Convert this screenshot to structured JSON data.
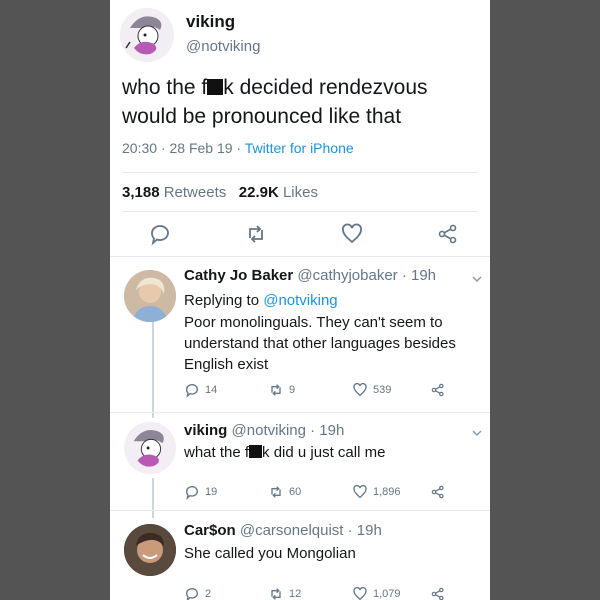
{
  "main_tweet": {
    "display_name": "viking",
    "handle": "@notviking",
    "text_before": "who the f",
    "text_after": "k decided rendezvous would be pronounced like that",
    "timestamp": "20:30 · 28 Feb 19 · ",
    "client": "Twitter for iPhone",
    "retweets_count": "3,188",
    "retweets_label": "Retweets",
    "likes_count": "22.9K",
    "likes_label": "Likes"
  },
  "replies": [
    {
      "display_name": "Cathy Jo Baker",
      "handle": "@cathyjobaker · 19h",
      "replying_label": "Replying to ",
      "replying_handle": "@notviking",
      "text": "Poor monolinguals. They can't seem to understand that other languages besides English exist",
      "reply_count": "14",
      "retweet_count": "9",
      "like_count": "539"
    },
    {
      "display_name": "viking",
      "handle": "@notviking · 19h",
      "text_before": "what the f",
      "text_after": "k did u just call me",
      "reply_count": "19",
      "retweet_count": "60",
      "like_count": "1,896"
    },
    {
      "display_name": "Car$on",
      "handle": "@carsonelquist · 19h",
      "text": "She called you Mongolian",
      "reply_count": "2",
      "retweet_count": "12",
      "like_count": "1,079"
    }
  ],
  "colors": {
    "background": "#545454",
    "card": "#ffffff",
    "link_blue": "#1b95e0",
    "muted_gray": "#657786",
    "text_dark": "#14171a"
  }
}
